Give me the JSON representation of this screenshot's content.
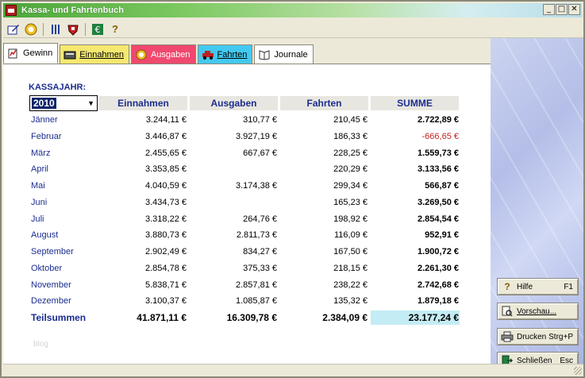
{
  "window": {
    "title": "Kassa- und Fahrtenbuch",
    "controls": [
      "_",
      "□",
      "✕"
    ]
  },
  "toolbar": {
    "icons": [
      "edit-icon",
      "sun-icon",
      "tools-icon",
      "crest-icon",
      "euro-icon",
      "help-icon"
    ]
  },
  "tabs": [
    {
      "label": "Gewinn",
      "icon": "chart-icon",
      "active": true
    },
    {
      "label": "Einnahmen",
      "icon": "register-icon"
    },
    {
      "label": "Ausgaben",
      "icon": "coin-icon"
    },
    {
      "label": "Fahrten",
      "icon": "car-icon"
    },
    {
      "label": "Journale",
      "icon": "book-icon"
    }
  ],
  "main": {
    "kassajahr_label": "KASSAJAHR:",
    "year": "2010",
    "columns": [
      "Einnahmen",
      "Ausgaben",
      "Fahrten",
      "SUMME"
    ],
    "rows": [
      {
        "month": "Jänner",
        "einnahmen": "3.244,11 €",
        "ausgaben": "310,77 €",
        "fahrten": "210,45 €",
        "summe": "2.722,89 €"
      },
      {
        "month": "Februar",
        "einnahmen": "3.446,87 €",
        "ausgaben": "3.927,19 €",
        "fahrten": "186,33 €",
        "summe": "-666,65 €",
        "negative": true
      },
      {
        "month": "März",
        "einnahmen": "2.455,65 €",
        "ausgaben": "667,67 €",
        "fahrten": "228,25 €",
        "summe": "1.559,73 €"
      },
      {
        "month": "April",
        "einnahmen": "3.353,85 €",
        "ausgaben": "",
        "fahrten": "220,29 €",
        "summe": "3.133,56 €"
      },
      {
        "month": "Mai",
        "einnahmen": "4.040,59 €",
        "ausgaben": "3.174,38 €",
        "fahrten": "299,34 €",
        "summe": "566,87 €"
      },
      {
        "month": "Juni",
        "einnahmen": "3.434,73 €",
        "ausgaben": "",
        "fahrten": "165,23 €",
        "summe": "3.269,50 €"
      },
      {
        "month": "Juli",
        "einnahmen": "3.318,22 €",
        "ausgaben": "264,76 €",
        "fahrten": "198,92 €",
        "summe": "2.854,54 €"
      },
      {
        "month": "August",
        "einnahmen": "3.880,73 €",
        "ausgaben": "2.811,73 €",
        "fahrten": "116,09 €",
        "summe": "952,91 €"
      },
      {
        "month": "September",
        "einnahmen": "2.902,49 €",
        "ausgaben": "834,27 €",
        "fahrten": "167,50 €",
        "summe": "1.900,72 €"
      },
      {
        "month": "Oktober",
        "einnahmen": "2.854,78 €",
        "ausgaben": "375,33 €",
        "fahrten": "218,15 €",
        "summe": "2.261,30 €"
      },
      {
        "month": "November",
        "einnahmen": "5.838,71 €",
        "ausgaben": "2.857,81 €",
        "fahrten": "238,22 €",
        "summe": "2.742,68 €"
      },
      {
        "month": "Dezember",
        "einnahmen": "3.100,37 €",
        "ausgaben": "1.085,87 €",
        "fahrten": "135,32 €",
        "summe": "1.879,18 €"
      }
    ],
    "totals": {
      "label": "Teilsummen",
      "einnahmen": "41.871,11 €",
      "ausgaben": "16.309,78 €",
      "fahrten": "2.384,09 €",
      "summe": "23.177,24 €"
    },
    "watermark": "blog"
  },
  "side_buttons": [
    {
      "label": "Hilfe",
      "key": "F1",
      "icon": "help-icon"
    },
    {
      "label": "Vorschau...",
      "key": "",
      "icon": "preview-icon"
    },
    {
      "label": "Drucken",
      "key": "Strg+P",
      "icon": "printer-icon"
    },
    {
      "label": "Schließen",
      "key": "Esc",
      "icon": "exit-icon"
    }
  ],
  "colors": {
    "header_text": "#1b2d8f",
    "negative": "#c02020",
    "tab_einnahmen": "#f5e870",
    "tab_ausgaben": "#f0486e",
    "tab_fahrten": "#43c9f0",
    "total_highlight": "#c4ecf4"
  }
}
